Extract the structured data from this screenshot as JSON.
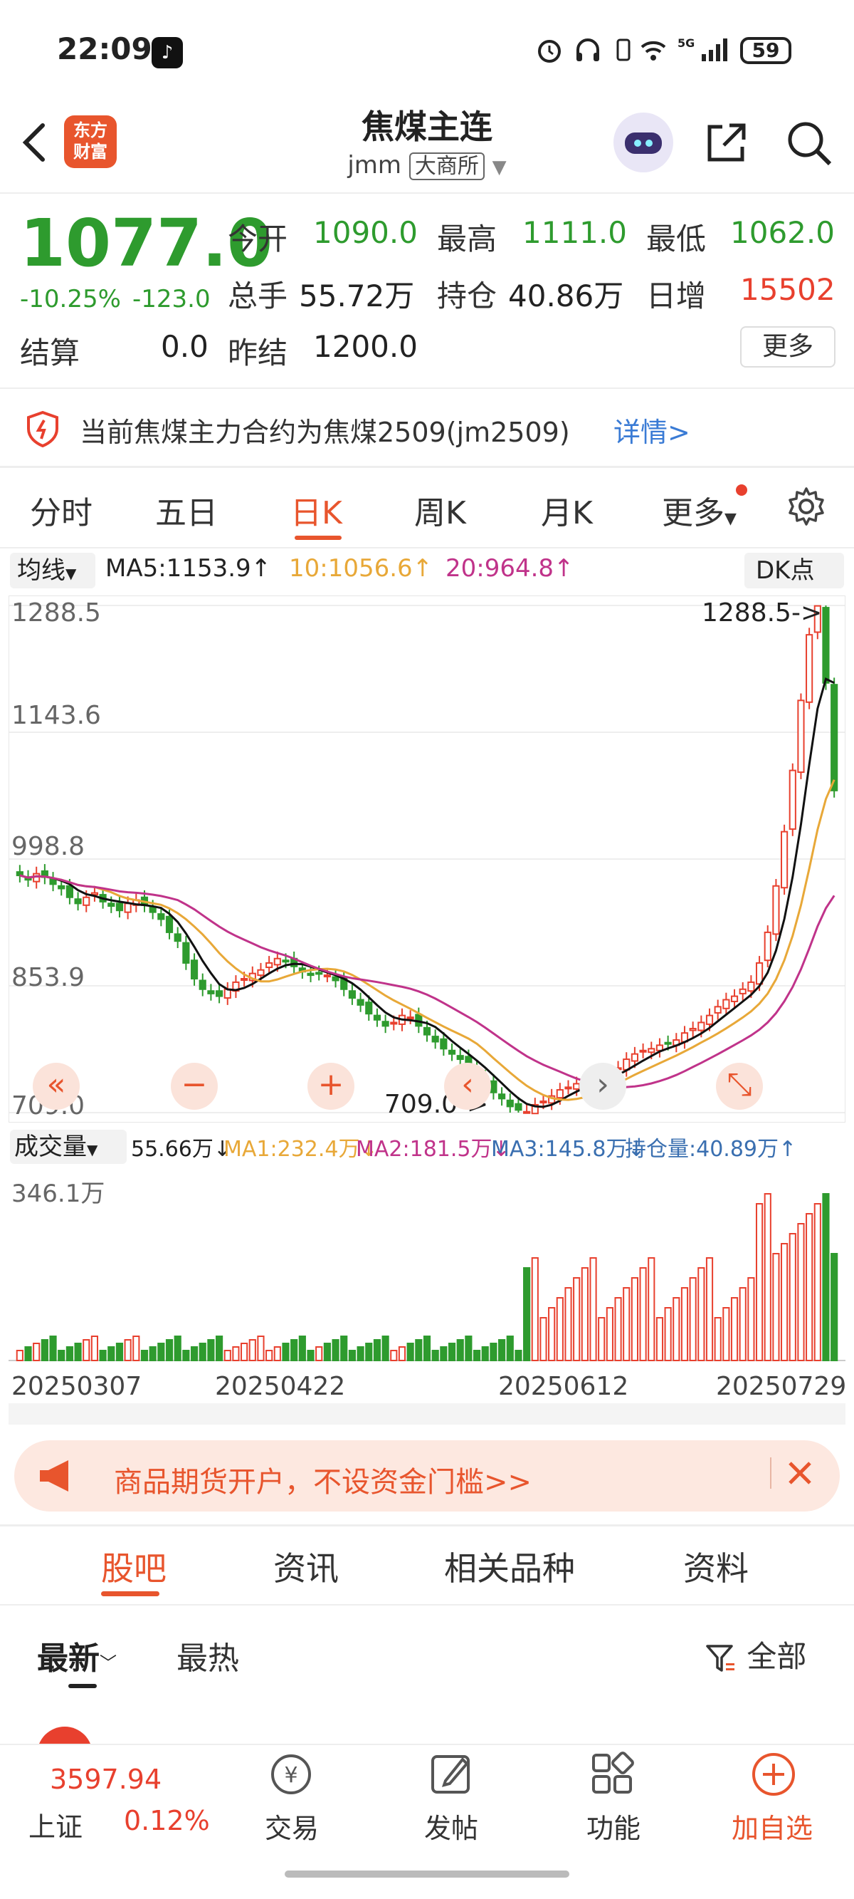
{
  "status_bar": {
    "time": "22:09",
    "battery": "59"
  },
  "header": {
    "title": "焦煤主连",
    "code": "jmm",
    "exchange": "大商所",
    "logo_line1": "东方",
    "logo_line2": "财富"
  },
  "quote": {
    "price": "1077.0",
    "change_pct": "-10.25%",
    "change": "-123.0",
    "open_label": "今开",
    "open": "1090.0",
    "high_label": "最高",
    "high": "1111.0",
    "low_label": "最低",
    "low": "1062.0",
    "volume_label": "总手",
    "volume": "55.72万",
    "oi_label": "持仓",
    "oi": "40.86万",
    "day_inc_label": "日增",
    "day_inc": "15502",
    "settle_label": "结算",
    "settle": "0.0",
    "prev_settle_label": "昨结",
    "prev_settle": "1200.0",
    "more_label": "更多"
  },
  "notice": {
    "text": "当前焦煤主力合约为焦煤2509(jm2509)",
    "link": "详情>"
  },
  "period_tabs": [
    "分时",
    "五日",
    "日K",
    "周K",
    "月K",
    "更多"
  ],
  "indicators": {
    "ma_button": "均线",
    "ma5": "MA5:1153.9↑",
    "ma10": "10:1056.6↑",
    "ma20": "20:964.8↑",
    "dk_button": "DK点",
    "ma10_color": "#e8a838",
    "ma20_color": "#c0338a"
  },
  "chart_axes": {
    "y_labels": [
      "1288.5",
      "1143.6",
      "998.8",
      "853.9",
      "709.0"
    ],
    "max_marker": "1288.5->",
    "min_marker": "709.0->"
  },
  "chart_controls": [
    "«",
    "−",
    "+",
    "‹",
    "›",
    "⤡"
  ],
  "volume": {
    "button": "成交量",
    "value": "55.66万↓",
    "ma1": "MA1:232.4万↓",
    "ma2": "MA2:181.5万↓",
    "ma3": "MA3:145.8万↓",
    "oi": "持仓量:40.89万↑",
    "max_label": "346.1万"
  },
  "dates": [
    "20250307",
    "20250422",
    "20250612",
    "20250729"
  ],
  "banner": {
    "text": "商品期货开户，不设资金门槛>>"
  },
  "lower_tabs": [
    "股吧",
    "资讯",
    "相关品种",
    "资料"
  ],
  "sort": {
    "newest": "最新",
    "hottest": "最热",
    "filter": "全部"
  },
  "bottom_nav": {
    "index_value": "3597.94",
    "index_name": "上证",
    "index_change": "0.12%",
    "items": [
      "交易",
      "发帖",
      "功能",
      "加自选"
    ]
  },
  "chart_data": {
    "type": "candlestick",
    "ylim": [
      709.0,
      1288.5
    ],
    "x_ticks": [
      "20250307",
      "20250422",
      "20250612",
      "20250729"
    ],
    "close": [
      980,
      975,
      982,
      978,
      970,
      965,
      955,
      948,
      955,
      960,
      950,
      945,
      940,
      948,
      952,
      946,
      938,
      930,
      915,
      905,
      880,
      862,
      850,
      845,
      842,
      850,
      858,
      862,
      868,
      872,
      880,
      885,
      882,
      876,
      870,
      866,
      868,
      866,
      860,
      850,
      840,
      832,
      822,
      815,
      808,
      812,
      820,
      818,
      808,
      798,
      790,
      782,
      776,
      770,
      762,
      752,
      742,
      732,
      725,
      716,
      712,
      710,
      718,
      722,
      728,
      735,
      738,
      742,
      745,
      748,
      752,
      756,
      760,
      770,
      776,
      780,
      782,
      786,
      788,
      792,
      800,
      805,
      812,
      820,
      830,
      838,
      842,
      850,
      858,
      880,
      915,
      968,
      1030,
      1100,
      1180,
      1255,
      1288,
      1200,
      1077
    ]
  }
}
